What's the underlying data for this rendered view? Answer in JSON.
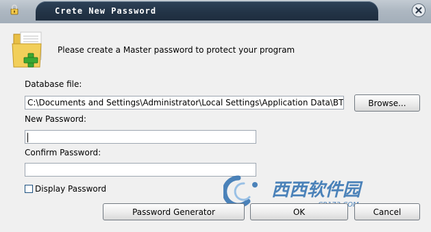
{
  "window": {
    "title": "Crete New Password",
    "icons": {
      "title_icon": "lock-icon",
      "close": "close-icon",
      "dialog_icon": "folder-add-icon"
    }
  },
  "intro_text": "Please create a Master password to protect your program",
  "database": {
    "label": "Database file:",
    "value": "C:\\Documents and Settings\\Administrator\\Local Settings\\Application Data\\BTOWS P",
    "browse_label": "Browse..."
  },
  "new_password": {
    "label": "New Password:",
    "value": ""
  },
  "confirm_password": {
    "label": "Confirm Password:",
    "value": ""
  },
  "display_password": {
    "label": "Display Password",
    "checked": false
  },
  "buttons": {
    "generator": "Password Generator",
    "ok": "OK",
    "cancel": "Cancel"
  },
  "watermark": {
    "text": "西西软件园",
    "subtext": "CR173.COM"
  },
  "colors": {
    "title_bar": "#223447",
    "accent_green": "#3aa832",
    "folder_yellow": "#f2cf5a",
    "watermark_blue": "#2f6fb0"
  }
}
